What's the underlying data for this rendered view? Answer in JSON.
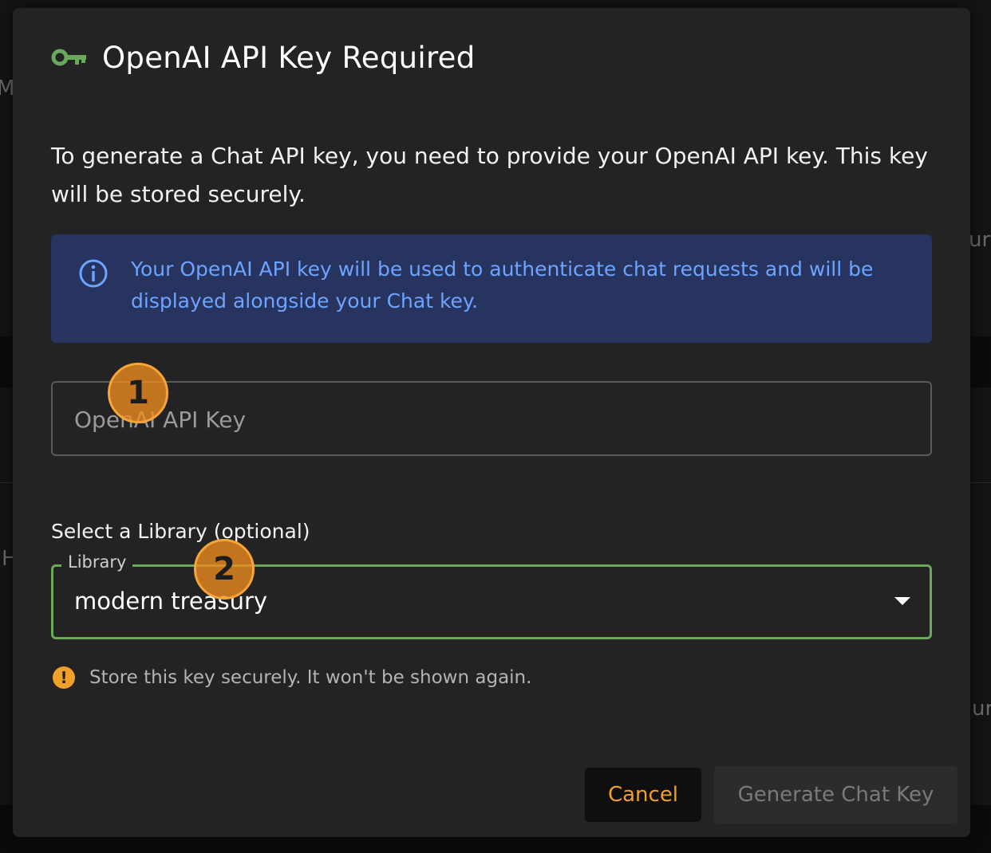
{
  "background": {
    "fragments": [
      "MO",
      "ur",
      "H",
      "ur"
    ]
  },
  "dialog": {
    "title": "OpenAI API Key Required",
    "title_icon": "key-icon",
    "description": "To generate a Chat API key, you need to provide your OpenAI API key. This key will be stored securely.",
    "info": {
      "icon": "info-icon",
      "text": "Your OpenAI API key will be used to authenticate chat requests and will be displayed alongside your Chat key."
    },
    "api_key_field": {
      "placeholder": "OpenAI API Key",
      "value": ""
    },
    "library_section": {
      "label": "Select a Library (optional)",
      "select_label": "Library",
      "selected_value": "modern treasury"
    },
    "warning": {
      "icon": "exclamation-icon",
      "icon_glyph": "!",
      "text": "Store this key securely. It won't be shown again."
    },
    "buttons": {
      "cancel": "Cancel",
      "generate": "Generate Chat Key"
    }
  },
  "markers": [
    {
      "label": "1"
    },
    {
      "label": "2"
    }
  ],
  "colors": {
    "accent_green": "#6aa85a",
    "info_background": "#26345f",
    "info_text": "#6ea3ff",
    "warning_orange": "#f0a02a",
    "dialog_background": "#232323"
  }
}
